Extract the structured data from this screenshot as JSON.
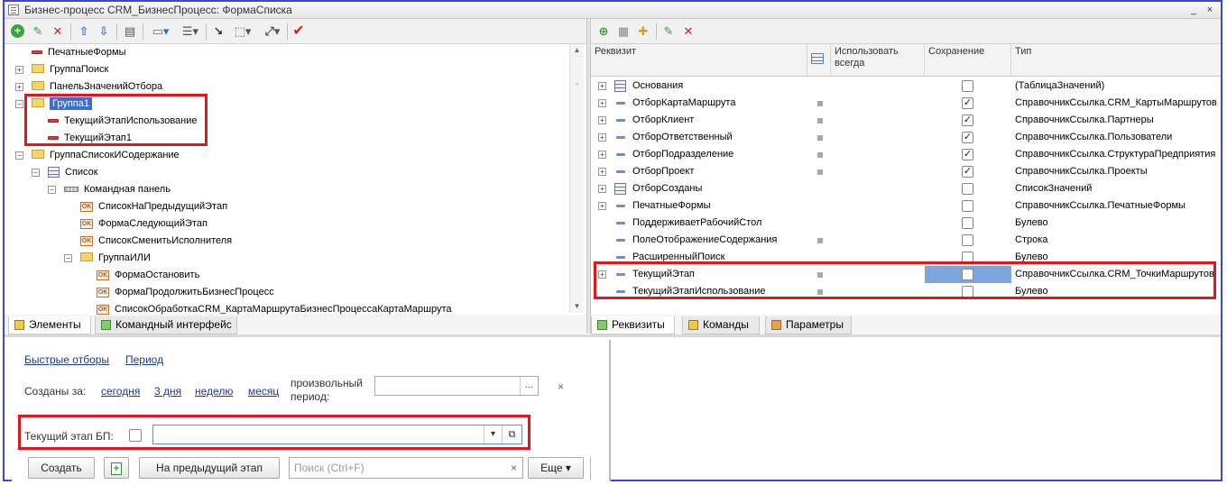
{
  "window": {
    "title": "Бизнес-процесс CRM_БизнесПроцесс: ФормаСписка",
    "controls": [
      "_",
      "×"
    ]
  },
  "left_toolbar": [
    "add-icon",
    "edit-icon",
    "delete-icon",
    "move-up-icon",
    "move-down-icon",
    "properties-icon",
    "form-view-icon",
    "layout-icon",
    "link-icon",
    "check-icon"
  ],
  "left_tree": {
    "items": [
      {
        "label": "ПечатныеФормы",
        "icon": "field-icon",
        "expander": ""
      },
      {
        "label": "ГруппаПоиск",
        "icon": "folder-icon",
        "expander": "+"
      },
      {
        "label": "ПанельЗначенийОтбора",
        "icon": "folder-icon",
        "expander": "+"
      },
      {
        "label": "Группа1",
        "icon": "folder-icon",
        "expander": "−",
        "selected": true
      },
      {
        "label": "ТекущийЭтапИспользование",
        "icon": "field-icon",
        "expander": ""
      },
      {
        "label": "ТекущийЭтап1",
        "icon": "field-icon",
        "expander": ""
      },
      {
        "label": "ГруппаСписокИСодержание",
        "icon": "folder-icon",
        "expander": "−"
      },
      {
        "label": "Список",
        "icon": "table-icon",
        "expander": "−"
      },
      {
        "label": "Командная панель",
        "icon": "command-panel-icon",
        "expander": "−"
      },
      {
        "label": "СписокНаПредыдущийЭтап",
        "icon": "ok-icon",
        "expander": ""
      },
      {
        "label": "ФормаСледующийЭтап",
        "icon": "ok-icon",
        "expander": ""
      },
      {
        "label": "СписокСменитьИсполнителя",
        "icon": "ok-icon",
        "expander": ""
      },
      {
        "label": "ГруппаИЛИ",
        "icon": "folder-icon",
        "expander": "−"
      },
      {
        "label": "ФормаОстановить",
        "icon": "ok-icon",
        "expander": ""
      },
      {
        "label": "ФормаПродолжитьБизнесПроцесс",
        "icon": "ok-icon",
        "expander": ""
      },
      {
        "label": "СписокОбработкаCRM_КартаМаршрутаБизнесПроцессаКартаМаршрута",
        "icon": "ok-icon",
        "expander": ""
      }
    ],
    "ok_icon_text": "OK"
  },
  "left_tabs": [
    "Элементы",
    "Командный интерфейс"
  ],
  "right_toolbar": [
    "add-attr-icon",
    "table-icon",
    "add-column-icon",
    "edit-icon",
    "delete-icon"
  ],
  "right_table": {
    "headers": {
      "attr": "Реквизит",
      "use_always": "Использовать всегда",
      "save": "Сохранение",
      "type": "Тип"
    },
    "rows": [
      {
        "name": "Основания",
        "icon": "table",
        "expander": "+",
        "use": false,
        "save": false,
        "type": "(ТаблицаЗначений)"
      },
      {
        "name": "ОтборКартаМаршрута",
        "icon": "attr",
        "expander": "+",
        "use": true,
        "save": true,
        "type": "СправочникСсылка.CRM_КартыМаршрутов"
      },
      {
        "name": "ОтборКлиент",
        "icon": "attr",
        "expander": "+",
        "use": true,
        "save": true,
        "type": "СправочникСсылка.Партнеры"
      },
      {
        "name": "ОтборОтветственный",
        "icon": "attr",
        "expander": "+",
        "use": true,
        "save": true,
        "type": "СправочникСсылка.Пользователи"
      },
      {
        "name": "ОтборПодразделение",
        "icon": "attr",
        "expander": "+",
        "use": true,
        "save": true,
        "type": "СправочникСсылка.СтруктураПредприятия"
      },
      {
        "name": "ОтборПроект",
        "icon": "attr",
        "expander": "+",
        "use": true,
        "save": true,
        "type": "СправочникСсылка.Проекты"
      },
      {
        "name": "ОтборСозданы",
        "icon": "table",
        "expander": "+",
        "use": false,
        "save": false,
        "type": "СписокЗначений"
      },
      {
        "name": "ПечатныеФормы",
        "icon": "attr",
        "expander": "+",
        "use": false,
        "save": false,
        "type": "СправочникСсылка.ПечатныеФормы"
      },
      {
        "name": "ПоддерживаетРабочийСтол",
        "icon": "attr",
        "expander": "",
        "use": false,
        "save": false,
        "type": "Булево"
      },
      {
        "name": "ПолеОтображениеСодержания",
        "icon": "attr",
        "expander": "",
        "use": true,
        "save": false,
        "type": "Строка"
      },
      {
        "name": "РасширенныйПоиск",
        "icon": "attr",
        "expander": "",
        "use": false,
        "save": false,
        "type": "Булево"
      },
      {
        "name": "ТекущийЭтап",
        "icon": "attr",
        "expander": "+",
        "use": true,
        "save": false,
        "type": "СправочникСсылка.CRM_ТочкиМаршрутов",
        "save_selected": true
      },
      {
        "name": "ТекущийЭтапИспользование",
        "icon": "attr",
        "expander": "",
        "use": true,
        "save": false,
        "type": "Булево"
      }
    ],
    "check_mark": "✓"
  },
  "right_tabs": [
    "Реквизиты",
    "Команды",
    "Параметры"
  ],
  "form_preview": {
    "quick_filters": "Быстрые отборы",
    "period": "Период",
    "created_for": "Созданы за:",
    "today": "сегодня",
    "three_days": "3 дня",
    "week": "неделю",
    "month": "месяц",
    "custom_period": "произвольный период:",
    "ellipsis": "...",
    "clear": "×",
    "current_stage_label": "Текущий этап БП:",
    "dropdown_arrow": "▾",
    "open_icon": "⧉",
    "create_button": "Создать",
    "prev_stage_button": "На предыдущий этап",
    "search_placeholder": "Поиск (Ctrl+F)",
    "more_button": "Еще ▾"
  }
}
